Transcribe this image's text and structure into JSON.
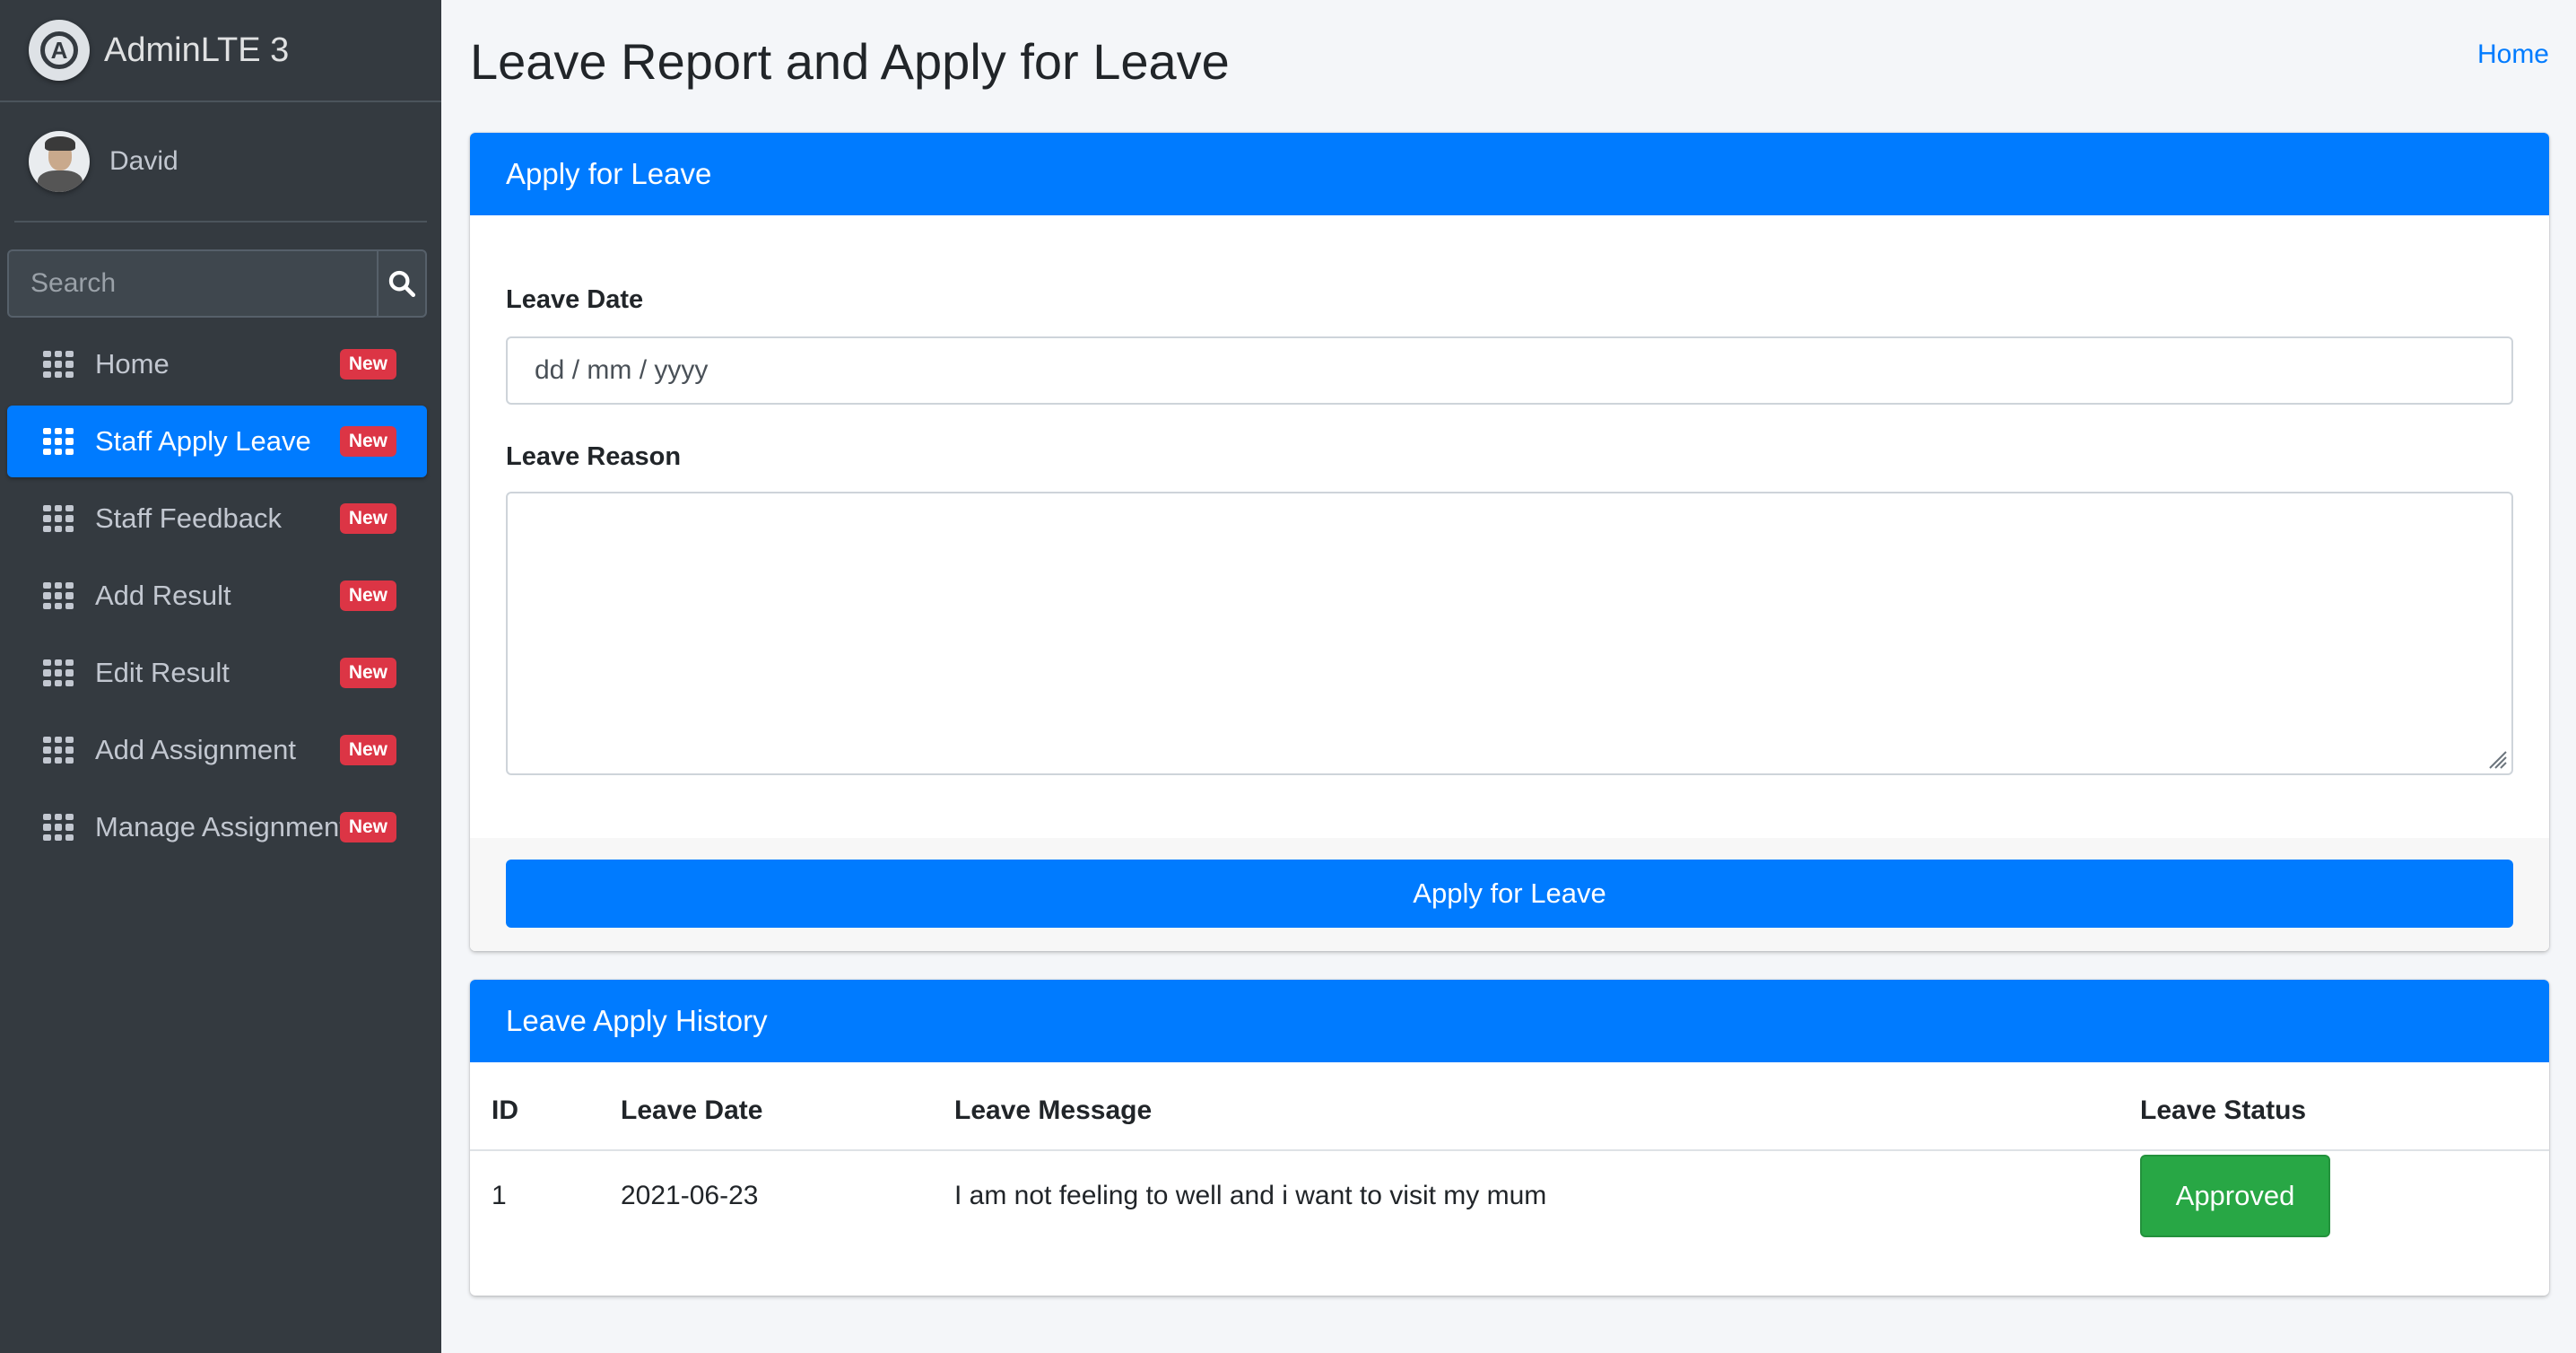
{
  "brand": {
    "name": "AdminLTE 3"
  },
  "user": {
    "name": "David"
  },
  "search": {
    "placeholder": "Search"
  },
  "sidebar": {
    "items": [
      {
        "label": "Home",
        "badge": "New",
        "active": false
      },
      {
        "label": "Staff Apply Leave",
        "badge": "New",
        "active": true
      },
      {
        "label": "Staff Feedback",
        "badge": "New",
        "active": false
      },
      {
        "label": "Add Result",
        "badge": "New",
        "active": false
      },
      {
        "label": "Edit Result",
        "badge": "New",
        "active": false
      },
      {
        "label": "Add Assignment",
        "badge": "New",
        "active": false
      },
      {
        "label": "Manage Assignments",
        "badge": "New",
        "active": false
      }
    ]
  },
  "header": {
    "title": "Leave Report and Apply for Leave",
    "breadcrumb": "Home"
  },
  "apply_card": {
    "title": "Apply for Leave",
    "date_label": "Leave Date",
    "date_placeholder": "dd / mm / yyyy",
    "reason_label": "Leave Reason",
    "reason_value": "",
    "submit_label": "Apply for Leave"
  },
  "history_card": {
    "title": "Leave Apply History",
    "columns": [
      "ID",
      "Leave Date",
      "Leave Message",
      "Leave Status"
    ],
    "rows": [
      {
        "id": "1",
        "date": "2021-06-23",
        "message": "I am not feeling to well and i want to visit my mum",
        "status": "Approved"
      }
    ]
  },
  "colors": {
    "primary": "#007bff",
    "sidebar_bg": "#343a40",
    "badge": "#dc3545",
    "success": "#28a745"
  },
  "icons": {
    "brand": "adminlte-logo-icon",
    "search": "search-icon",
    "nav": "grid-icon",
    "resize": "resize-handle-icon"
  }
}
